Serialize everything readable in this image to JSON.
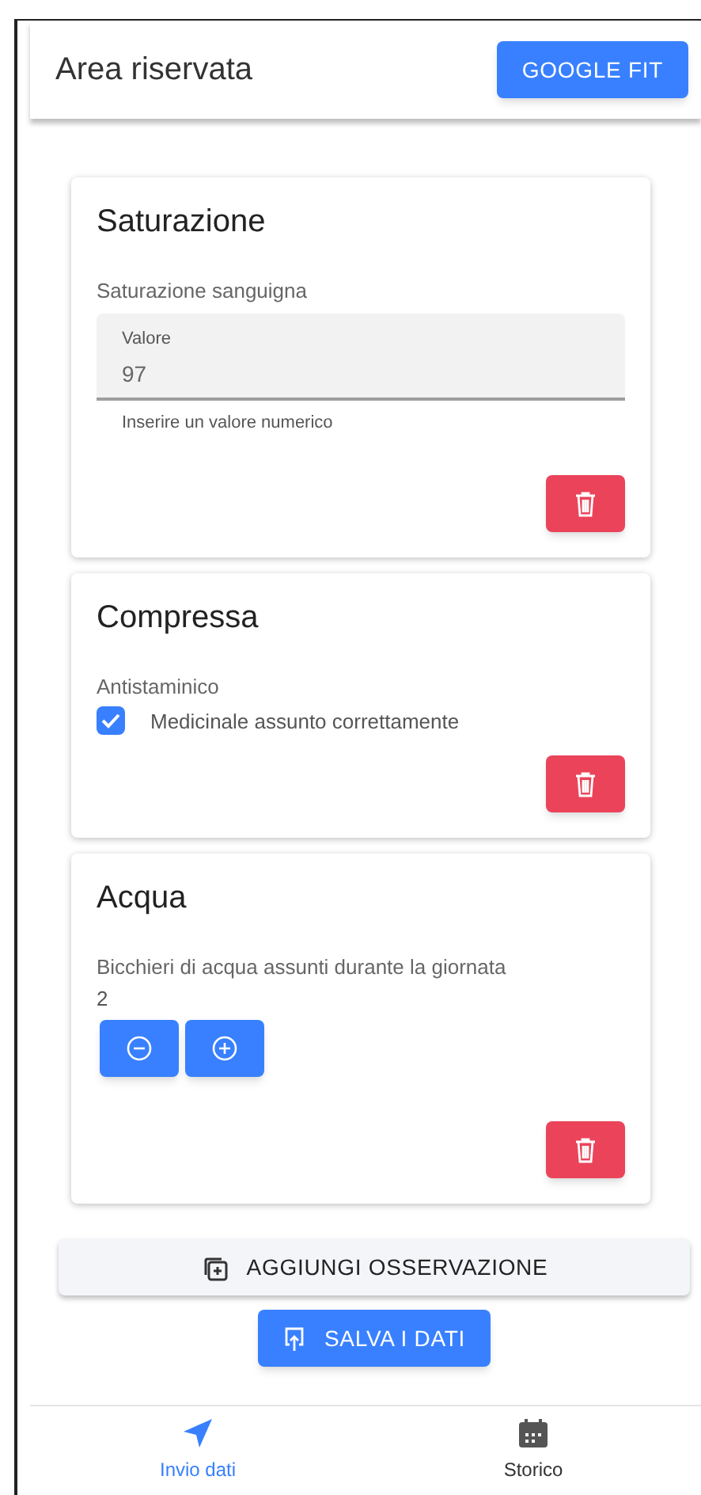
{
  "header": {
    "title": "Area riservata",
    "action": "GOOGLE FIT"
  },
  "observations": [
    {
      "kind": "field",
      "title": "Saturazione",
      "subtitle": "Saturazione sanguigna",
      "label": "Valore",
      "value": "97",
      "hint": "Inserire un valore numerico"
    },
    {
      "kind": "checkbox",
      "title": "Compressa",
      "subtitle": "Antistaminico",
      "label": "Medicinale assunto correttamente",
      "checked": true
    },
    {
      "kind": "counter",
      "title": "Acqua",
      "subtitle": "Bicchieri di acqua assunti durante la giornata",
      "value": "2"
    }
  ],
  "add_button": "AGGIUNGI OSSERVAZIONE",
  "save_button": "SALVA I DATI",
  "bottom_nav": [
    {
      "label": "Invio dati",
      "kind": "send",
      "selected": true
    },
    {
      "label": "Storico",
      "kind": "calendar",
      "selected": false
    }
  ]
}
